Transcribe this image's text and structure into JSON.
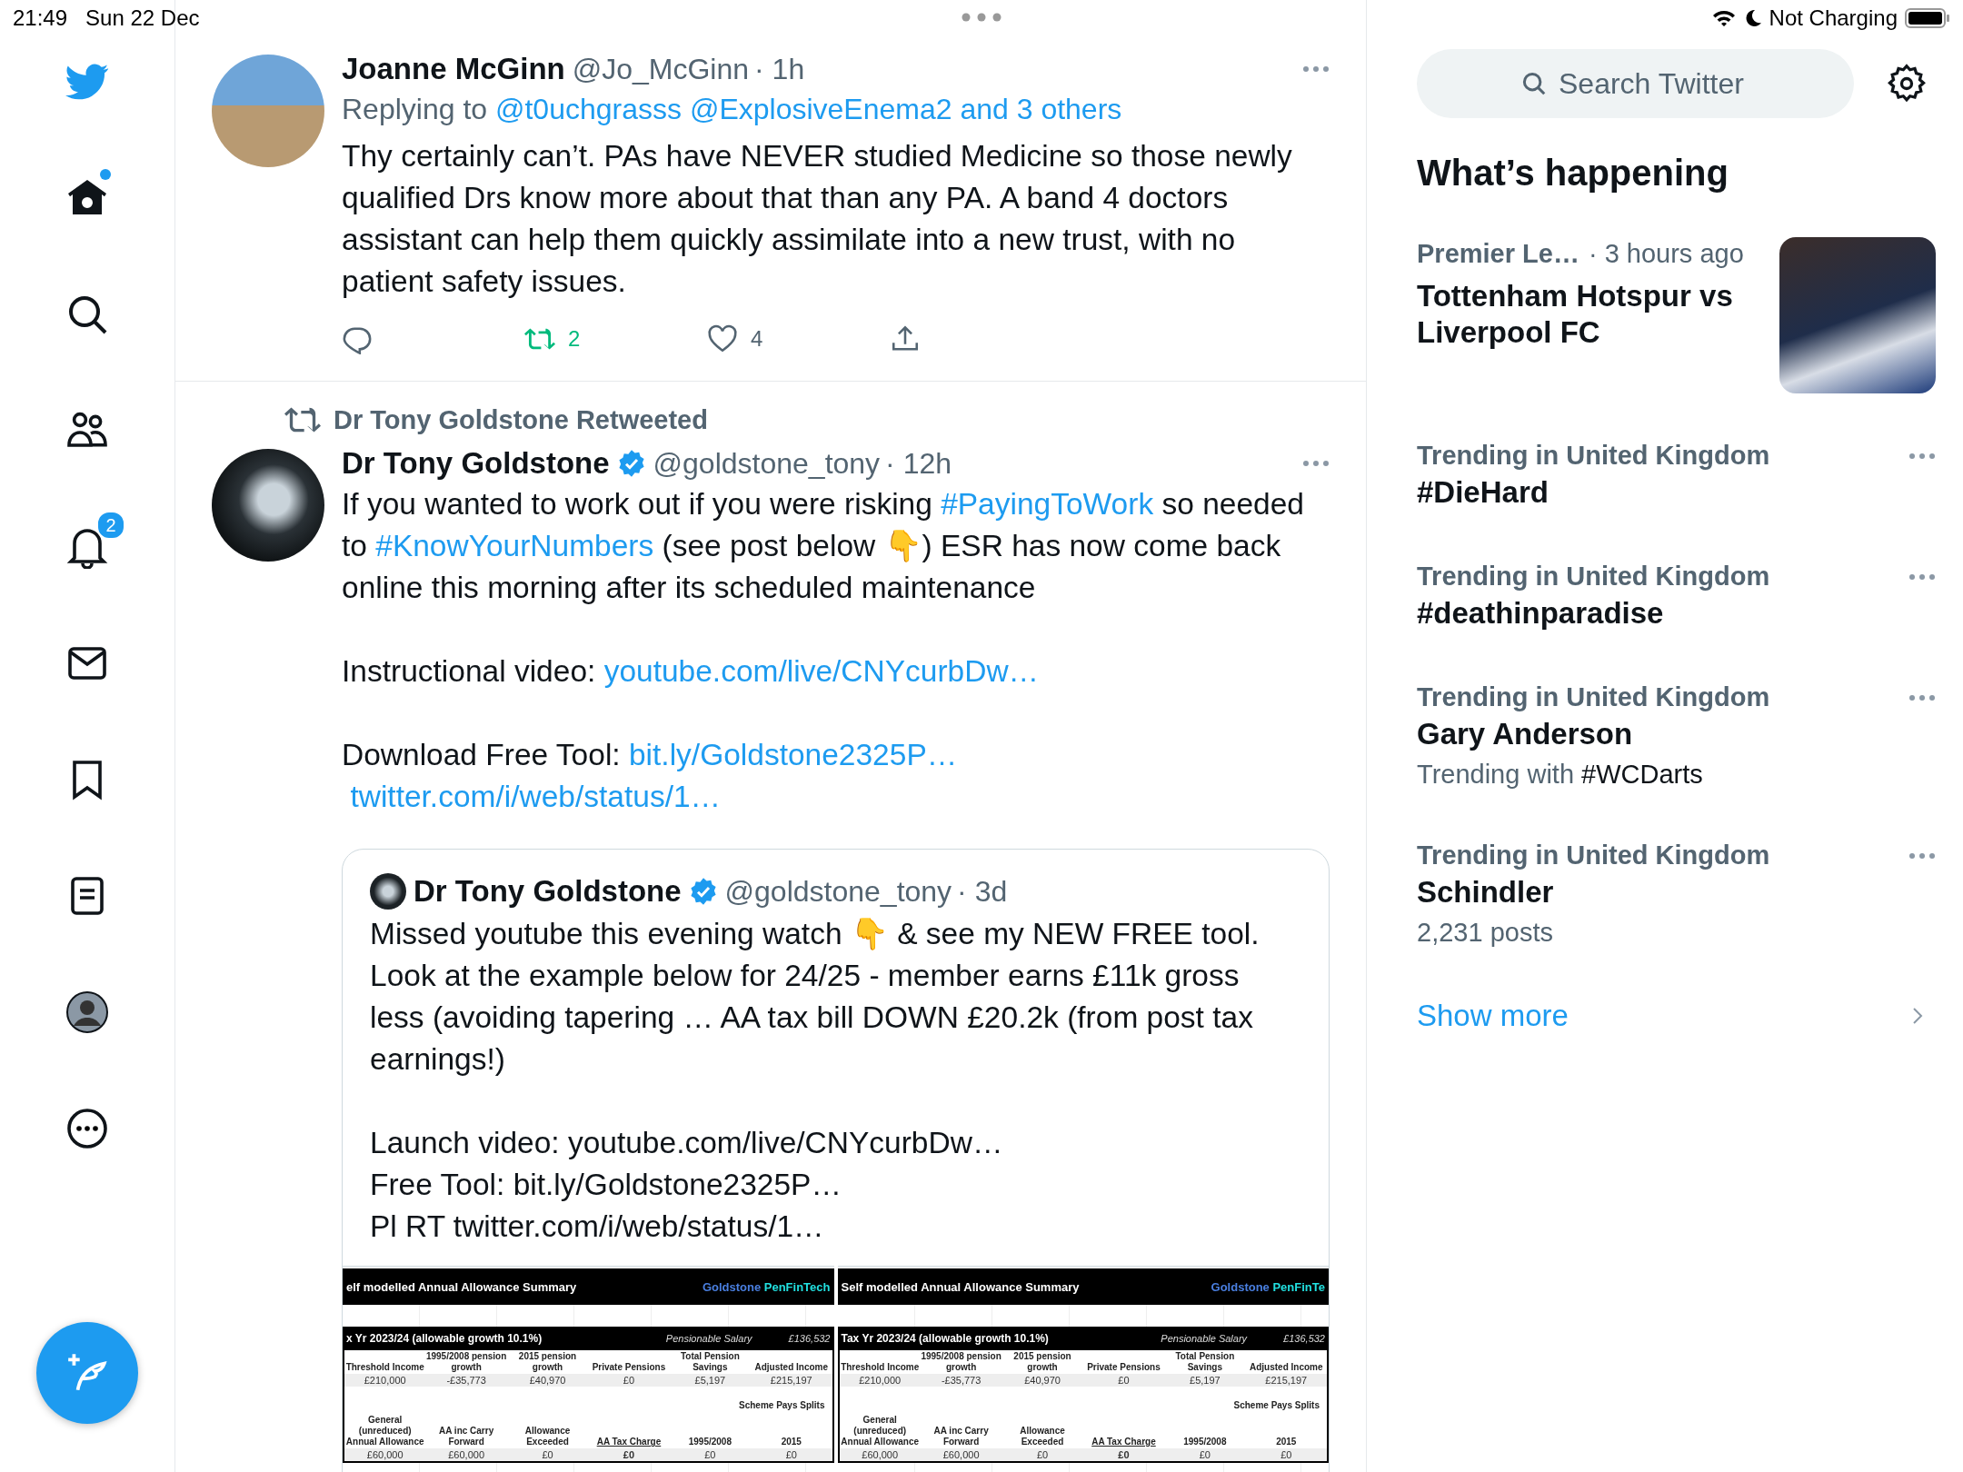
{
  "status_bar": {
    "time": "21:49",
    "date": "Sun 22 Dec",
    "battery_text": "Not Charging"
  },
  "nav": {
    "items": [
      {
        "kind": "logo"
      },
      {
        "kind": "home",
        "new_dot": true
      },
      {
        "kind": "search"
      },
      {
        "kind": "communities"
      },
      {
        "kind": "notifications",
        "badge": "2"
      },
      {
        "kind": "messages"
      },
      {
        "kind": "bookmarks"
      },
      {
        "kind": "lists"
      },
      {
        "kind": "profile"
      },
      {
        "kind": "more"
      }
    ]
  },
  "tweets": [
    {
      "name": "Joanne McGinn",
      "verified": false,
      "handle": "@Jo_McGinn",
      "time": "· 1h",
      "replying": [
        {
          "t": "Replying to ",
          "link": false
        },
        {
          "t": "@t0uchgrasss @ExplosiveEnema2 and 3 others",
          "link": true
        }
      ],
      "paragraphs": [
        [
          {
            "t": "Thy certainly can’t. PAs have NEVER studied Medicine so those newly qualified Drs know more about that than any PA. A band 4 doctors assistant can help them quickly assimilate into a new trust, with no patient safety issues.",
            "link": false
          }
        ]
      ],
      "actions": [
        {
          "kind": "reply",
          "active": false
        },
        {
          "kind": "retweet",
          "count": "2",
          "active": true
        },
        {
          "kind": "like",
          "count": "4",
          "active": false
        },
        {
          "kind": "share",
          "active": false
        }
      ]
    },
    {
      "retweeted_by": "Dr Tony Goldstone Retweeted",
      "name": "Dr Tony Goldstone",
      "verified": true,
      "handle": "@goldstone_tony",
      "time": "· 12h",
      "paragraphs": [
        [
          {
            "t": "If you wanted to work out if you were risking ",
            "link": false
          },
          {
            "t": "#PayingToWork",
            "link": true
          },
          {
            "t": " so needed to ",
            "link": false
          },
          {
            "t": "#KnowYourNumbers",
            "link": true
          },
          {
            "t": " (see post below 👇) ESR has now come back online this morning after its scheduled maintenance",
            "link": false
          }
        ],
        [
          {
            "t": "Instructional video: ",
            "link": false
          },
          {
            "t": "youtube.com/live/CNYcurbDw…",
            "link": true
          }
        ],
        [
          {
            "t": "Download Free Tool: ",
            "link": false
          },
          {
            "t": "bit.ly/Goldstone2325P…",
            "link": true
          },
          {
            "t": "twitter.com/i/web/status/1…",
            "link": true
          }
        ]
      ],
      "quote": {
        "name": "Dr Tony Goldstone",
        "verified": true,
        "handle": "@goldstone_tony",
        "time": "· 3d",
        "paragraphs": [
          "Missed youtube this evening watch 👇 & see my NEW FREE tool. Look at the example below for 24/25 - member earns £11k gross less (avoiding tapering … AA tax bill DOWN £20.2k (from post tax earnings!)",
          "Launch video: youtube.com/live/CNYcurbDw…\nFree Tool: bit.ly/Goldstone2325P…\nPl RT twitter.com/i/web/status/1…"
        ],
        "sheets": [
          {
            "title": "elf modelled Annual Allowance Summary",
            "brand": [
              {
                "t": "Goldstone ",
                "color": "#4a7fe0"
              },
              {
                "t": "PenFinTech",
                "color": "#22e0e0"
              }
            ],
            "section": "x Yr 2023/24 (allowable growth 10.1%)",
            "salary_label": "Pensionable Salary",
            "salary_value": "£136,532",
            "head1": [
              "Threshold Income",
              "1995/2008 pension growth",
              "2015 pension growth",
              "Private Pensions",
              "Total Pension Savings",
              "Adjusted Income"
            ],
            "vals1": [
              "£210,000",
              "-£35,773",
              "£40,970",
              "£0",
              "£5,197",
              "£215,197"
            ],
            "splits": "Scheme Pays Splits",
            "head2": [
              "General (unreduced) Annual Allowance",
              "AA inc Carry Forward",
              "Allowance Exceeded",
              "AA Tax Charge",
              "1995/2008",
              "2015"
            ],
            "vals2": [
              "£60,000",
              "£60,000",
              "£0",
              "£0",
              "£0",
              "£0"
            ]
          },
          {
            "title": "Self modelled Annual Allowance Summary",
            "brand": [
              {
                "t": "Goldstone ",
                "color": "#4a7fe0"
              },
              {
                "t": "PenFinTe",
                "color": "#22e0e0"
              }
            ],
            "section": "Tax Yr 2023/24 (allowable growth 10.1%)",
            "salary_label": "Pensionable Salary",
            "salary_value": "£136,532",
            "head1": [
              "Threshold Income",
              "1995/2008 pension growth",
              "2015 pension growth",
              "Private Pensions",
              "Total Pension Savings",
              "Adjusted Income"
            ],
            "vals1": [
              "£210,000",
              "-£35,773",
              "£40,970",
              "£0",
              "£5,197",
              "£215,197"
            ],
            "splits": "Scheme Pays Splits",
            "head2": [
              "General (unreduced) Annual Allowance",
              "AA inc Carry Forward",
              "Allowance Exceeded",
              "AA Tax Charge",
              "1995/2008",
              "2015"
            ],
            "vals2": [
              "£60,000",
              "£60,000",
              "£0",
              "£0",
              "£0",
              "£0"
            ]
          }
        ]
      }
    }
  ],
  "sidebar": {
    "search": {
      "placeholder": "Search Twitter"
    },
    "heading": "What’s happening",
    "trends": [
      {
        "kind": "news",
        "source": "Premier Le…",
        "time": "· 3 hours ago",
        "title": "Tottenham Hotspur vs Liverpool FC"
      },
      {
        "kind": "trend",
        "context": "Trending in United Kingdom",
        "title": "#DieHard"
      },
      {
        "kind": "trend",
        "context": "Trending in United Kingdom",
        "title": "#deathinparadise"
      },
      {
        "kind": "trend",
        "context": "Trending in United Kingdom",
        "title": "Gary Anderson",
        "sub": [
          {
            "t": "Trending with ",
            "strong": false
          },
          {
            "t": "#WCDarts",
            "strong": true
          }
        ]
      },
      {
        "kind": "trend",
        "context": "Trending in United Kingdom",
        "title": "Schindler",
        "sub": [
          {
            "t": "2,231 posts",
            "strong": false
          }
        ]
      }
    ],
    "show_more": "Show more"
  }
}
